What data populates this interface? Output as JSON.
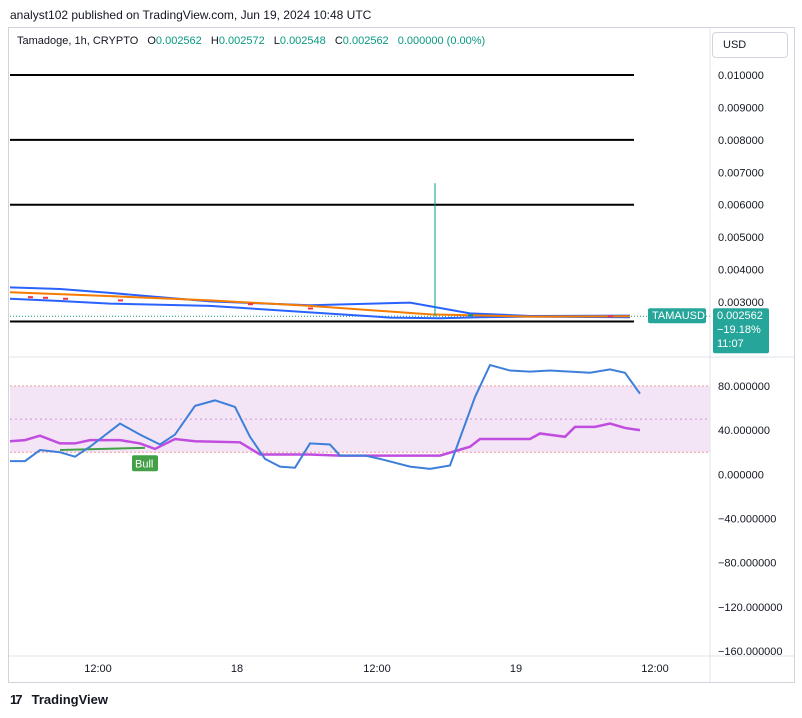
{
  "header": {
    "published": "analyst102 published on TradingView.com, Jun 19, 2024 10:48 UTC"
  },
  "legend": {
    "symbol": "Tamadoge, 1h, CRYPTO",
    "o_label": "O",
    "o": "0.002562",
    "h_label": "H",
    "h": "0.002572",
    "l_label": "L",
    "l": "0.002548",
    "c_label": "C",
    "c": "0.002562",
    "change": "0.000000 (0.00%)"
  },
  "currency_button": "USD",
  "price_tag": {
    "ticker": "TAMAUSD",
    "price": "0.002562",
    "change": "−19.18%",
    "countdown": "11:07"
  },
  "bull_label": "Bull",
  "footer": {
    "brand": "TradingView"
  },
  "colors": {
    "up": "#089981",
    "down": "#f23645",
    "bb": "#2962ff",
    "ma": "#f57c00",
    "k": "#3d7fd9",
    "d": "#c04ce0",
    "tag": "#26a69a",
    "band": "#f3e5f5"
  },
  "chart_data": [
    {
      "type": "line",
      "name": "price panel",
      "y_ticks": [
        "0.010000",
        "0.009000",
        "0.008000",
        "0.007000",
        "0.006000",
        "0.005000",
        "0.004000",
        "0.003000"
      ],
      "ylim": [
        0.00225,
        0.0111
      ],
      "x_ticks": [
        "12:00",
        "18",
        "12:00",
        "19",
        "12:00"
      ],
      "horizontal_levels": [
        0.01,
        0.008,
        0.006,
        0.0024
      ],
      "bollinger_upper": [
        [
          0,
          0.00345
        ],
        [
          50,
          0.0034
        ],
        [
          100,
          0.00328
        ],
        [
          200,
          0.00302
        ],
        [
          300,
          0.0029
        ],
        [
          400,
          0.00298
        ],
        [
          460,
          0.00265
        ],
        [
          520,
          0.00257
        ],
        [
          620,
          0.00258
        ]
      ],
      "bollinger_lower": [
        [
          0,
          0.0031
        ],
        [
          50,
          0.00303
        ],
        [
          100,
          0.00295
        ],
        [
          200,
          0.00288
        ],
        [
          300,
          0.00268
        ],
        [
          380,
          0.00252
        ],
        [
          430,
          0.0025
        ],
        [
          470,
          0.00253
        ],
        [
          520,
          0.00255
        ],
        [
          620,
          0.00253
        ]
      ],
      "moving_average": [
        [
          0,
          0.0033
        ],
        [
          100,
          0.00318
        ],
        [
          200,
          0.00305
        ],
        [
          300,
          0.00288
        ],
        [
          420,
          0.00262
        ],
        [
          520,
          0.00255
        ],
        [
          620,
          0.00256
        ]
      ],
      "spike": {
        "x": 425,
        "high": 0.00666,
        "low": 0.00256
      },
      "last_price": 0.002562
    },
    {
      "type": "line",
      "name": "stochastic rsi",
      "y_ticks": [
        "80.000000",
        "40.000000",
        "0.000000",
        "−40.000000",
        "−80.000000",
        "−120.000000",
        "−160.000000"
      ],
      "ylim": [
        -160,
        100
      ],
      "band": [
        20,
        80
      ],
      "k": [
        [
          0,
          12
        ],
        [
          15,
          12
        ],
        [
          30,
          22
        ],
        [
          50,
          20
        ],
        [
          65,
          16
        ],
        [
          80,
          25
        ],
        [
          110,
          46
        ],
        [
          130,
          36
        ],
        [
          150,
          27
        ],
        [
          165,
          36
        ],
        [
          185,
          62
        ],
        [
          205,
          67
        ],
        [
          225,
          61
        ],
        [
          240,
          34
        ],
        [
          255,
          14
        ],
        [
          270,
          7
        ],
        [
          285,
          6
        ],
        [
          300,
          28
        ],
        [
          320,
          27
        ],
        [
          330,
          17
        ],
        [
          355,
          17
        ],
        [
          370,
          14
        ],
        [
          400,
          7
        ],
        [
          420,
          5
        ],
        [
          440,
          8
        ],
        [
          465,
          70
        ],
        [
          480,
          99
        ],
        [
          500,
          94
        ],
        [
          520,
          93
        ],
        [
          540,
          94
        ],
        [
          580,
          92
        ],
        [
          600,
          95
        ],
        [
          615,
          92
        ],
        [
          630,
          73
        ]
      ],
      "d": [
        [
          0,
          30
        ],
        [
          15,
          31
        ],
        [
          30,
          35
        ],
        [
          50,
          28
        ],
        [
          65,
          28
        ],
        [
          80,
          31
        ],
        [
          110,
          31
        ],
        [
          130,
          28
        ],
        [
          145,
          23
        ],
        [
          165,
          32
        ],
        [
          185,
          30
        ],
        [
          230,
          29
        ],
        [
          250,
          18
        ],
        [
          300,
          18
        ],
        [
          330,
          17
        ],
        [
          380,
          17
        ],
        [
          430,
          17
        ],
        [
          460,
          25
        ],
        [
          470,
          32
        ],
        [
          520,
          32
        ],
        [
          530,
          37
        ],
        [
          555,
          34
        ],
        [
          565,
          43
        ],
        [
          585,
          43
        ],
        [
          600,
          46
        ],
        [
          615,
          42
        ],
        [
          630,
          40
        ]
      ],
      "bull_signal_line": [
        [
          50,
          22
        ],
        [
          135,
          24
        ]
      ]
    }
  ]
}
